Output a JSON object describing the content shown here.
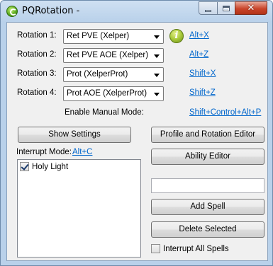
{
  "window": {
    "title": "PQRotation -"
  },
  "rotations": [
    {
      "label": "Rotation 1:",
      "value": "Ret PVE (Xelper)",
      "hotkey": "Alt+X"
    },
    {
      "label": "Rotation 2:",
      "value": "Ret PVE AOE (Xelper)",
      "hotkey": "Alt+Z"
    },
    {
      "label": "Rotation 3:",
      "value": "Prot (XelperProt)",
      "hotkey": "Shift+X"
    },
    {
      "label": "Rotation 4:",
      "value": "Prot AOE (XelperProt)",
      "hotkey": "Shift+Z"
    }
  ],
  "manual_mode": {
    "label": "Enable Manual Mode:",
    "hotkey": "Shift+Control+Alt+P"
  },
  "buttons": {
    "show_settings": "Show Settings",
    "profile_editor": "Profile and Rotation Editor",
    "ability_editor": "Ability Editor",
    "add_spell": "Add Spell",
    "delete_selected": "Delete Selected"
  },
  "interrupt": {
    "label": "Interrupt Mode:",
    "hotkey": "Alt+C",
    "items": [
      {
        "label": "Holy Light",
        "checked": true
      }
    ],
    "all_spells_label": "Interrupt All Spells",
    "all_spells_checked": false
  },
  "spell_input": {
    "value": ""
  },
  "icons": {
    "app": "pqrotation-app-icon",
    "info": "info-icon"
  }
}
